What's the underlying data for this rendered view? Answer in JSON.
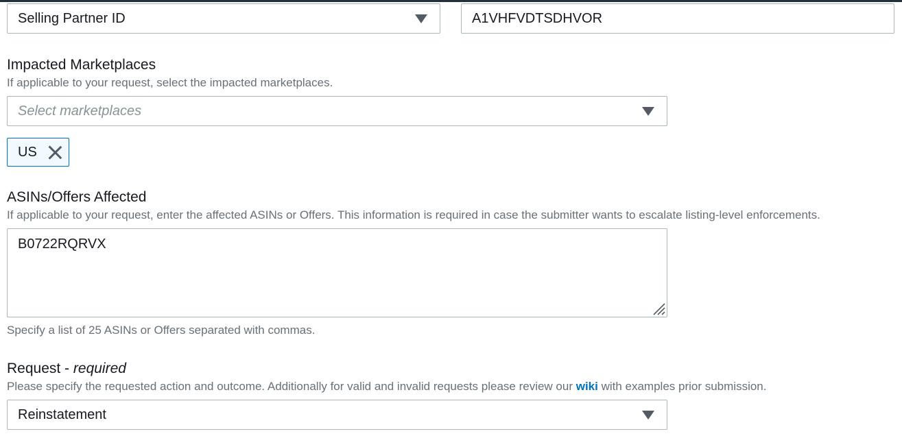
{
  "partner_id": {
    "type_select_value": "Selling Partner ID",
    "id_value": "A1VHFVDTSDHVOR"
  },
  "marketplaces": {
    "label": "Impacted Marketplaces",
    "description": "If applicable to your request, select the impacted marketplaces.",
    "placeholder": "Select marketplaces",
    "selected_tokens": [
      {
        "label": "US"
      }
    ]
  },
  "asins": {
    "label": "ASINs/Offers Affected",
    "description": "If applicable to your request, enter the affected ASINs or Offers. This information is required in case the submitter wants to escalate listing-level enforcements.",
    "value": "B0722RQRVX",
    "hint": "Specify a list of 25 ASINs or Offers separated with commas."
  },
  "request": {
    "label": "Request - ",
    "required_text": "required",
    "description_before": "Please specify the requested action and outcome. Additionally for valid and invalid requests please review our ",
    "wiki_link": "wiki",
    "description_after": " with examples prior submission.",
    "select_value": "Reinstatement"
  },
  "icons": {
    "dropdown": "caret-down-icon",
    "remove_token": "close-icon",
    "resize": "resize-grip-icon"
  },
  "colors": {
    "link": "#0073bb",
    "token_border": "#0073bb",
    "token_bg": "#f1faff",
    "border": "#aab7b8",
    "muted_text": "#687078"
  }
}
